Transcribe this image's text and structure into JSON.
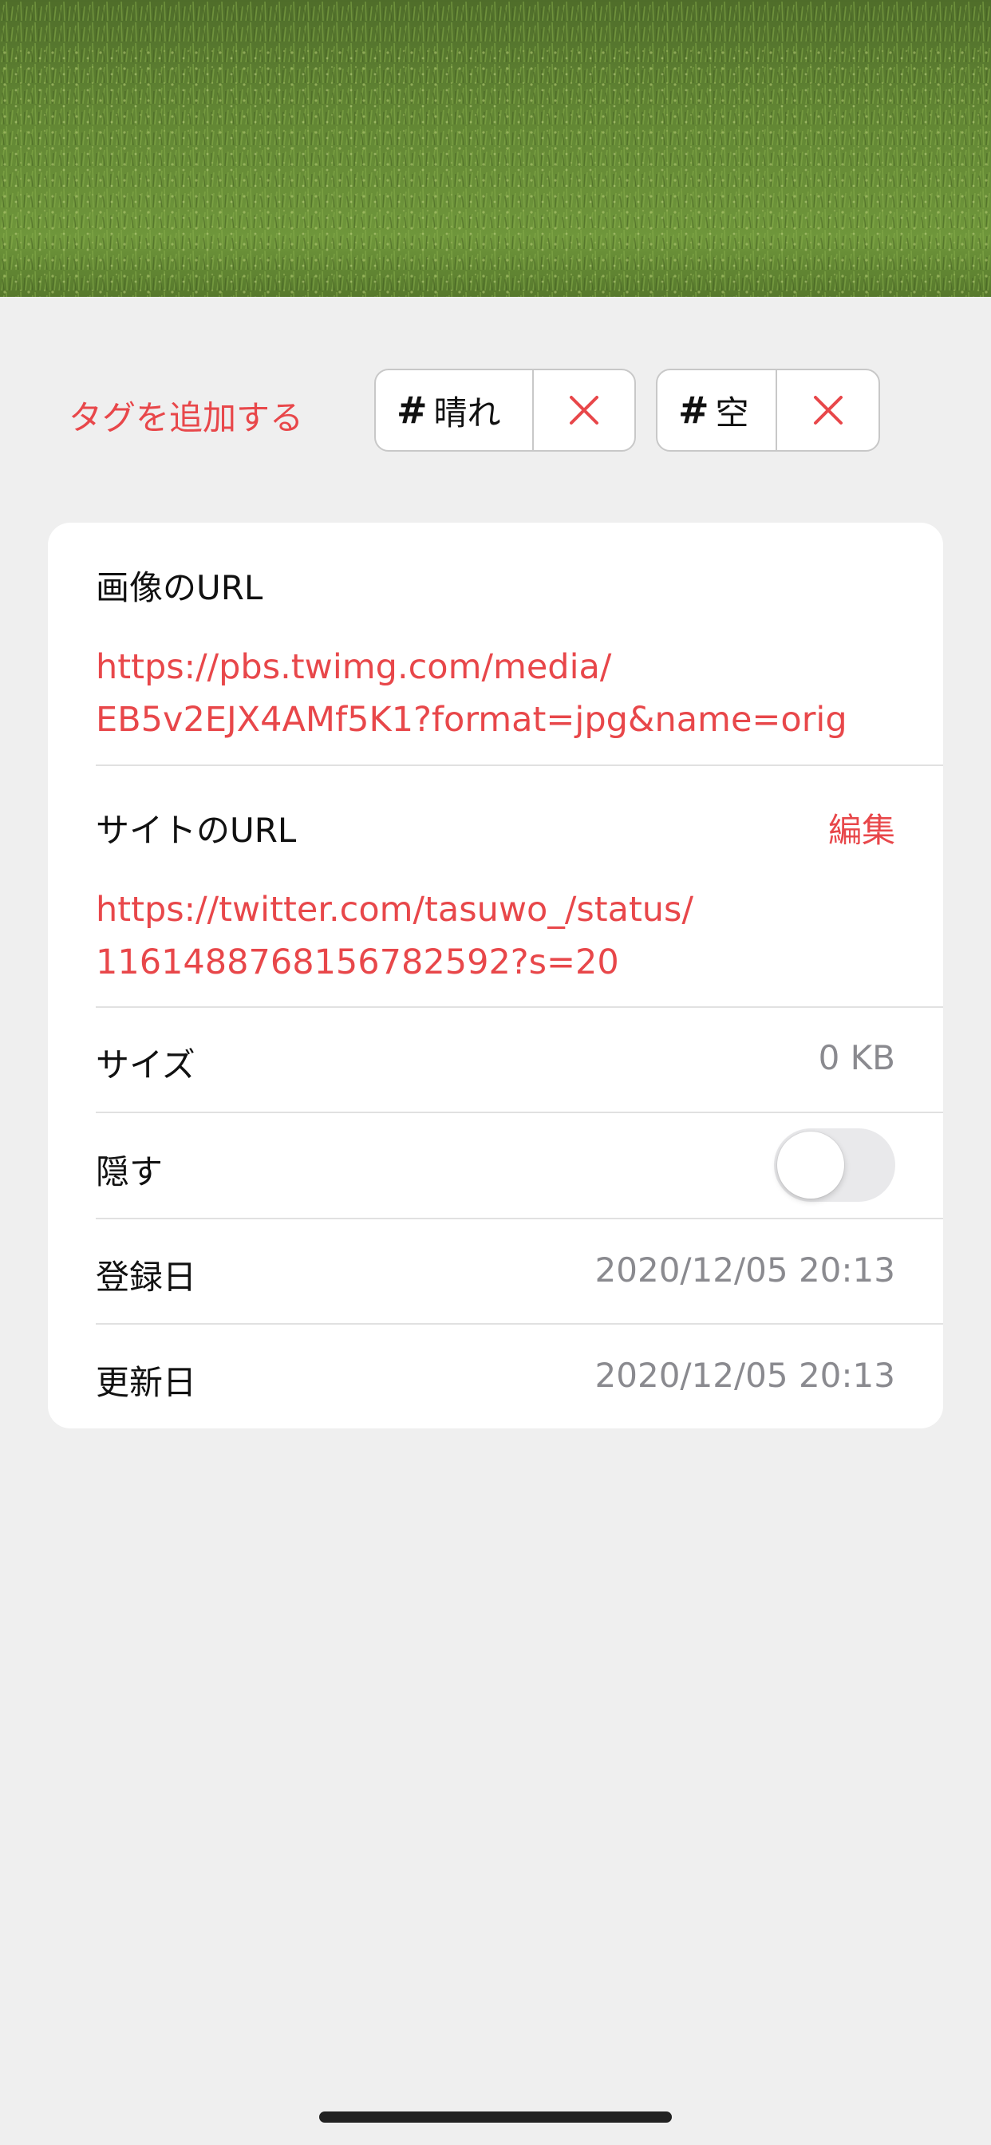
{
  "hero_image": {
    "description_icon": "rice-field-photo"
  },
  "tags": {
    "add_label": "タグを追加する",
    "items": [
      {
        "hash": "#",
        "label": "晴れ"
      },
      {
        "hash": "#",
        "label": "空"
      }
    ],
    "remove_icon": "close-icon"
  },
  "details": {
    "image_url": {
      "label": "画像のURL",
      "line1": "https://pbs.twimg.com/media/",
      "line2": "EB5v2EJX4AMf5K1?format=jpg&name=orig"
    },
    "site_url": {
      "label": "サイトのURL",
      "edit_label": "編集",
      "line1": "https://twitter.com/tasuwo_/status/",
      "line2": "1161488768156782592?s=20"
    },
    "size": {
      "label": "サイズ",
      "value": "0 KB"
    },
    "hide": {
      "label": "隠す",
      "enabled": false
    },
    "registered": {
      "label": "登録日",
      "value": "2020/12/05 20:13"
    },
    "updated": {
      "label": "更新日",
      "value": "2020/12/05 20:13"
    }
  },
  "colors": {
    "accent": "#e8474a",
    "background": "#efefef",
    "card": "#ffffff",
    "secondary_text": "#8a8a8f"
  }
}
